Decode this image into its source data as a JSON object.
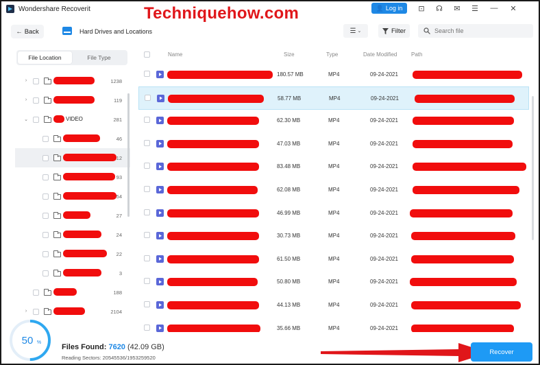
{
  "app": {
    "title": "Wondershare Recoverit",
    "watermark": "Techniquehow.com",
    "login_label": "Log in"
  },
  "toolbar": {
    "back_label": "Back",
    "location_title": "Hard Drives and Locations",
    "filter_label": "Filter",
    "search_placeholder": "Search file"
  },
  "sidebar": {
    "tabs": [
      {
        "label": "File Location",
        "active": true
      },
      {
        "label": "File Type",
        "active": false
      }
    ],
    "tree": [
      {
        "name": "",
        "count": "1238",
        "indent": 0,
        "arrow": "›",
        "selected": false
      },
      {
        "name": "",
        "count": "119",
        "indent": 0,
        "arrow": "›",
        "selected": false
      },
      {
        "name": "VIDEO",
        "count": "281",
        "indent": 0,
        "arrow": "⌄",
        "selected": false
      },
      {
        "name": "",
        "count": "46",
        "indent": 1,
        "arrow": "",
        "selected": false
      },
      {
        "name": "",
        "count": "12",
        "indent": 1,
        "arrow": "",
        "selected": true
      },
      {
        "name": "",
        "count": "93",
        "indent": 1,
        "arrow": "",
        "selected": false
      },
      {
        "name": "",
        "count": "54",
        "indent": 1,
        "arrow": "",
        "selected": false
      },
      {
        "name": "",
        "count": "27",
        "indent": 1,
        "arrow": "",
        "selected": false
      },
      {
        "name": "",
        "count": "24",
        "indent": 1,
        "arrow": "",
        "selected": false
      },
      {
        "name": "",
        "count": "22",
        "indent": 1,
        "arrow": "",
        "selected": false
      },
      {
        "name": "",
        "count": "3",
        "indent": 1,
        "arrow": "",
        "selected": false
      },
      {
        "name": "",
        "count": "188",
        "indent": 0,
        "arrow": "",
        "selected": false
      },
      {
        "name": "",
        "count": "2104",
        "indent": 0,
        "arrow": "›",
        "selected": false
      }
    ]
  },
  "table": {
    "columns": [
      "Name",
      "Size",
      "Type",
      "Date Modified",
      "Path"
    ],
    "rows": [
      {
        "size": "180.57 MB",
        "type": "MP4",
        "date": "09-24-2021",
        "highlight": false
      },
      {
        "size": "58.77 MB",
        "type": "MP4",
        "date": "09-24-2021",
        "highlight": true
      },
      {
        "size": "62.30 MB",
        "type": "MP4",
        "date": "09-24-2021",
        "highlight": false
      },
      {
        "size": "47.03 MB",
        "type": "MP4",
        "date": "09-24-2021",
        "highlight": false
      },
      {
        "size": "83.48 MB",
        "type": "MP4",
        "date": "09-24-2021",
        "highlight": false
      },
      {
        "size": "62.08 MB",
        "type": "MP4",
        "date": "09-24-2021",
        "highlight": false
      },
      {
        "size": "46.99 MB",
        "type": "MP4",
        "date": "09-24-2021",
        "highlight": false
      },
      {
        "size": "30.73 MB",
        "type": "MP4",
        "date": "09-24-2021",
        "highlight": false
      },
      {
        "size": "61.50 MB",
        "type": "MP4",
        "date": "09-24-2021",
        "highlight": false
      },
      {
        "size": "50.80 MB",
        "type": "MP4",
        "date": "09-24-2021",
        "highlight": false
      },
      {
        "size": "44.13 MB",
        "type": "MP4",
        "date": "09-24-2021",
        "highlight": false
      },
      {
        "size": "35.66 MB",
        "type": "MP4",
        "date": "09-24-2021",
        "highlight": false
      }
    ]
  },
  "footer": {
    "progress_value": "50",
    "progress_unit": "%",
    "files_found_label": "Files Found:",
    "files_found_count": "7620",
    "files_found_size": "(42.09 GB)",
    "reading_label": "Reading Sectors: 20545536/1953259520",
    "recover_label": "Recover"
  },
  "colors": {
    "accent": "#1e88e5",
    "recover": "#1e9af5",
    "highlight_row": "#dff2fb",
    "redaction": "#f10d0d",
    "video_icon": "#5a67d8"
  }
}
